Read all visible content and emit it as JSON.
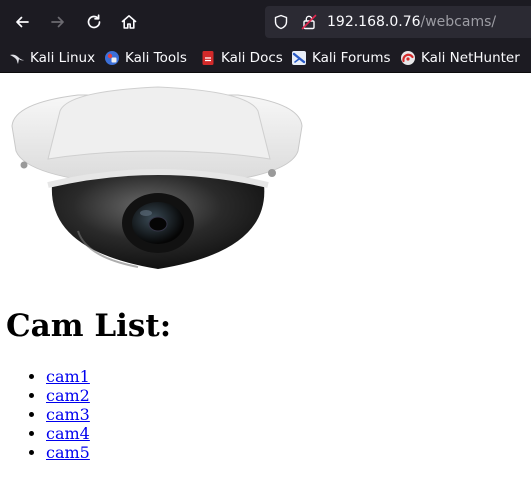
{
  "browser": {
    "url_host": "192.168.0.76",
    "url_path": "/webcams/",
    "icons": {
      "back": "arrow-left-icon",
      "forward": "arrow-right-icon",
      "reload": "reload-icon",
      "home": "home-icon",
      "shield": "shield-icon",
      "lock": "lock-icon"
    }
  },
  "bookmarks": [
    {
      "label": "Kali Linux",
      "icon": "kali-dragon-icon"
    },
    {
      "label": "Kali Tools",
      "icon": "kali-tools-icon"
    },
    {
      "label": "Kali Docs",
      "icon": "kali-docs-icon"
    },
    {
      "label": "Kali Forums",
      "icon": "kali-forums-icon"
    },
    {
      "label": "Kali NetHunter",
      "icon": "kali-nethunter-icon"
    }
  ],
  "page": {
    "image": "dome-security-camera",
    "heading": "Cam List:",
    "cams": [
      "cam1",
      "cam2",
      "cam3",
      "cam4",
      "cam5"
    ]
  },
  "colors": {
    "toolbar_bg": "#1c1b22",
    "urlbar_bg": "#2b2a33",
    "link": "#0000ee"
  }
}
